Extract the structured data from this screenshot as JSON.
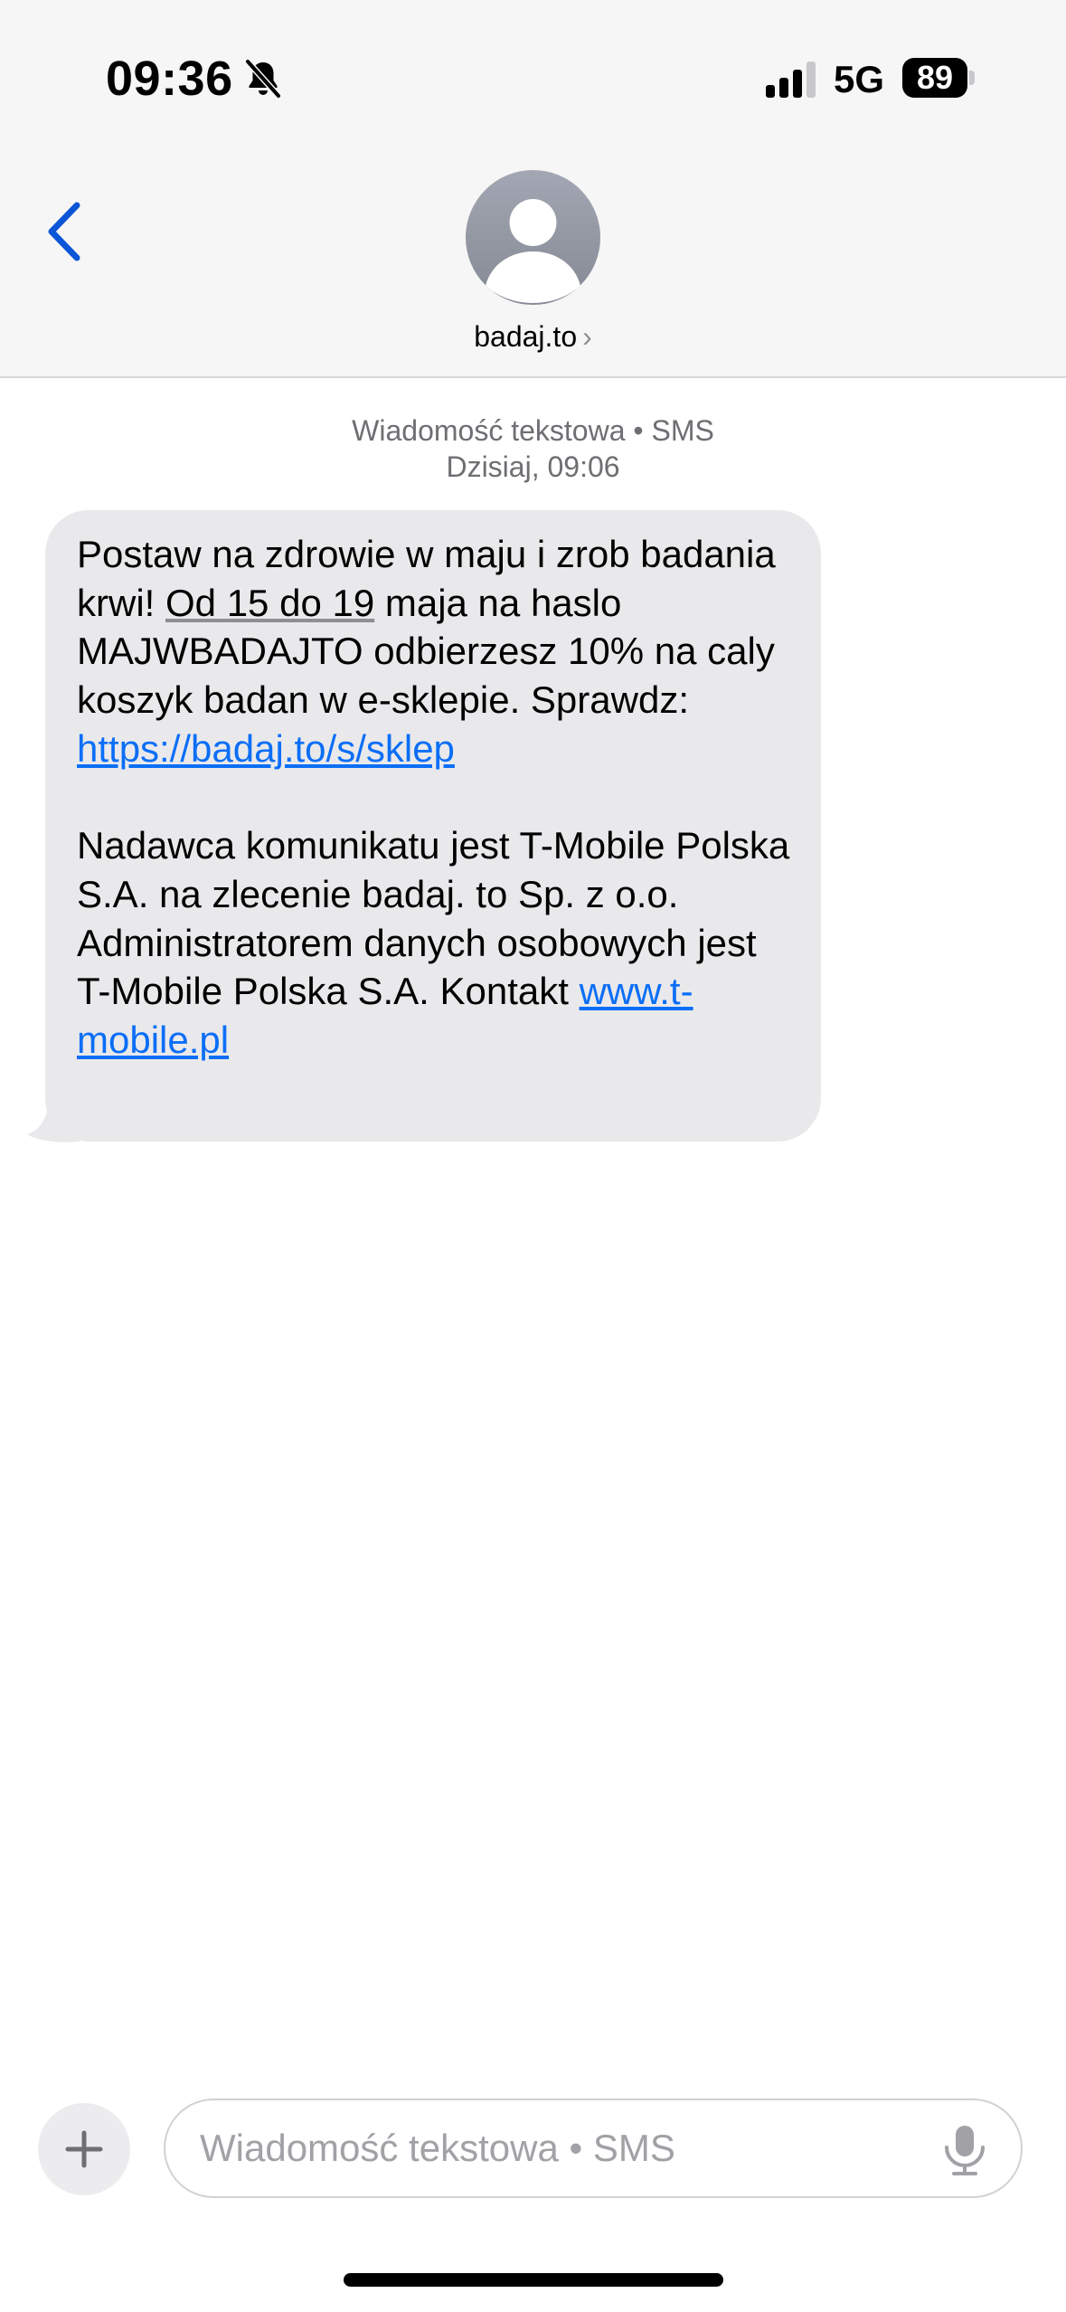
{
  "status_bar": {
    "time": "09:36",
    "network": "5G",
    "battery": "89"
  },
  "header": {
    "contact_name": "badaj.to",
    "chevron": "›"
  },
  "conversation": {
    "meta_line1": "Wiadomość tekstowa • SMS",
    "meta_line2": "Dzisiaj, 09:06",
    "message": {
      "p1_a": "Postaw na zdrowie w maju i zrob badania krwi! ",
      "p1_date": "Od 15 do 19",
      "p1_b": " maja na haslo MAJWBADAJTO odbierzesz 10% na caly koszyk badan w e-sklepie. Sprawdz: ",
      "p1_link": "https://badaj.to/s/sklep",
      "p2_a": "Nadawca komunikatu jest T-Mobile Polska S.A. na zlecenie badaj. to Sp. z o.o. Administratorem danych osobowych jest T-Mobile Polska S.A. Kontakt ",
      "p2_link": "www.t-mobile.pl"
    }
  },
  "composer": {
    "placeholder": "Wiadomość tekstowa • SMS"
  },
  "colors": {
    "accent": "#0b6ef7",
    "bubble": "#e9e9eb",
    "header_bg": "#f6f6f6"
  },
  "icons": [
    "bell-slash-icon",
    "cellular-signal-icon",
    "battery-icon",
    "back-chevron-icon",
    "person-icon",
    "plus-icon",
    "microphone-icon"
  ]
}
